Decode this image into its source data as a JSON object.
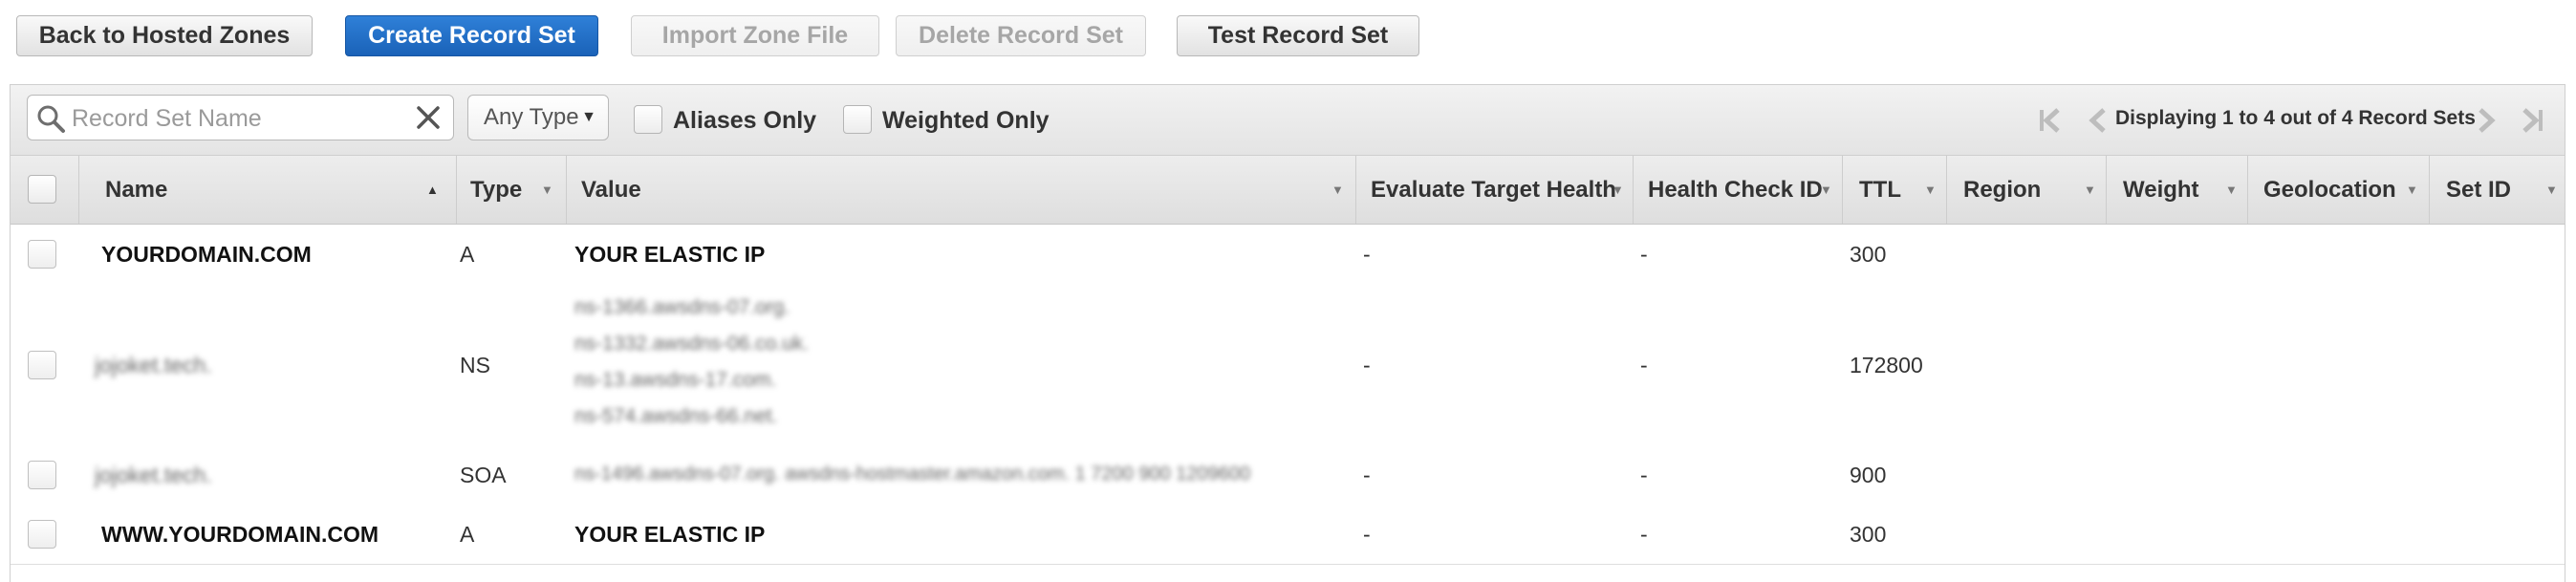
{
  "toolbar": {
    "back_label": "Back to Hosted Zones",
    "create_label": "Create Record Set",
    "import_label": "Import Zone File",
    "delete_label": "Delete Record Set",
    "test_label": "Test Record Set"
  },
  "filters": {
    "search_placeholder": "Record Set Name",
    "search_value": "",
    "type_selected": "Any Type",
    "aliases_label": "Aliases Only",
    "weighted_label": "Weighted Only"
  },
  "pagination": {
    "text": "Displaying 1 to 4 out of 4 Record Sets"
  },
  "columns": [
    "Name",
    "Type",
    "Value",
    "Evaluate Target Health",
    "Health Check ID",
    "TTL",
    "Region",
    "Weight",
    "Geolocation",
    "Set ID"
  ],
  "rows": [
    {
      "name": "YOURDOMAIN.COM",
      "type": "A",
      "value": [
        "YOUR ELASTIC IP"
      ],
      "eval": "-",
      "health": "-",
      "ttl": "300"
    },
    {
      "name": "jojoket.tech.",
      "type": "NS",
      "value": [
        "ns-1366.awsdns-07.org.",
        "ns-1332.awsdns-06.co.uk.",
        "ns-13.awsdns-17.com.",
        "ns-574.awsdns-66.net."
      ],
      "eval": "-",
      "health": "-",
      "ttl": "172800"
    },
    {
      "name": "jojoket.tech.",
      "type": "SOA",
      "value": [
        "ns-1496.awsdns-07.org. awsdns-hostmaster.amazon.com. 1 7200 900 1209600"
      ],
      "eval": "-",
      "health": "-",
      "ttl": "900"
    },
    {
      "name": "WWW.YOURDOMAIN.COM",
      "type": "A",
      "value": [
        "YOUR ELASTIC IP"
      ],
      "eval": "-",
      "health": "-",
      "ttl": "300"
    }
  ],
  "colors": {
    "primary": "#1f6fc6",
    "header_bg": "#e6e6e6",
    "border": "#cfcfcf"
  },
  "icons": [
    "search-icon",
    "clear-icon",
    "first-page-icon",
    "prev-page-icon",
    "next-page-icon",
    "last-page-icon",
    "sort-asc-icon",
    "sort-menu-icon"
  ]
}
